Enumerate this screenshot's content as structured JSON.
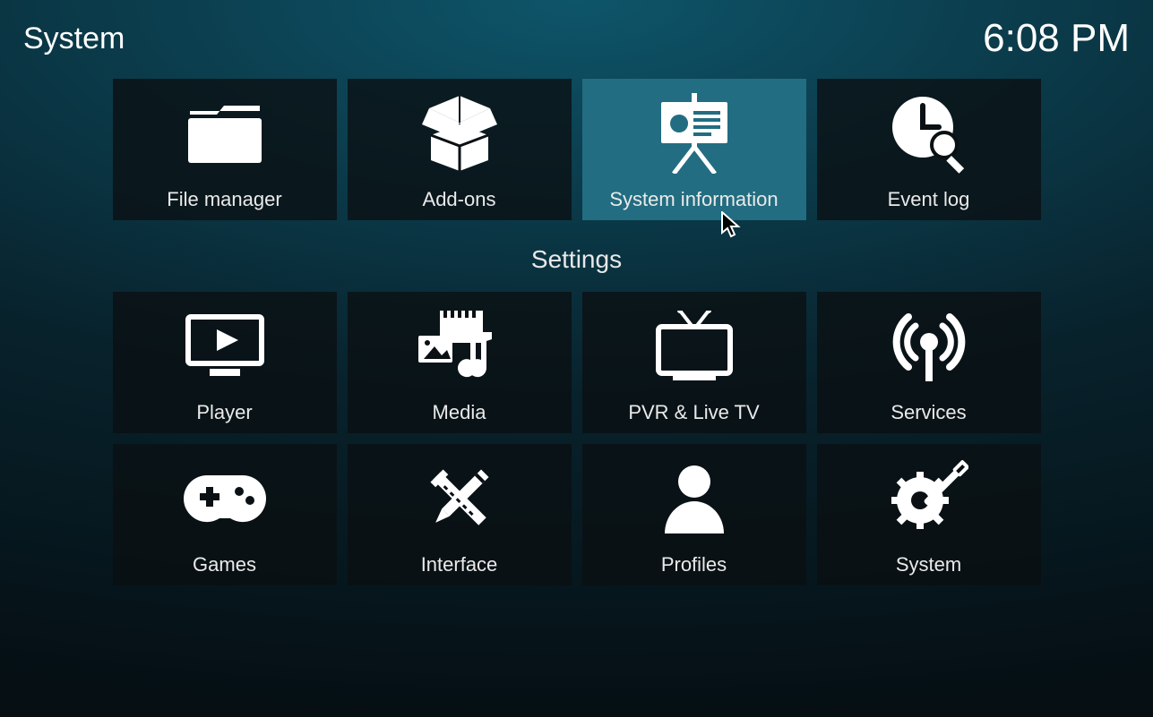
{
  "header": {
    "title": "System",
    "time": "6:08 PM"
  },
  "section_label": "Settings",
  "tiles_row1": [
    {
      "label": "File manager",
      "icon": "folder-icon"
    },
    {
      "label": "Add-ons",
      "icon": "box-icon"
    },
    {
      "label": "System information",
      "icon": "presentation-icon",
      "selected": true
    },
    {
      "label": "Event log",
      "icon": "clock-search-icon"
    }
  ],
  "tiles_row2": [
    {
      "label": "Player",
      "icon": "play-monitor-icon"
    },
    {
      "label": "Media",
      "icon": "media-icon"
    },
    {
      "label": "PVR & Live TV",
      "icon": "tv-icon"
    },
    {
      "label": "Services",
      "icon": "broadcast-icon"
    }
  ],
  "tiles_row3": [
    {
      "label": "Games",
      "icon": "gamepad-icon"
    },
    {
      "label": "Interface",
      "icon": "tools-icon"
    },
    {
      "label": "Profiles",
      "icon": "profile-icon"
    },
    {
      "label": "System",
      "icon": "gear-tool-icon"
    }
  ]
}
